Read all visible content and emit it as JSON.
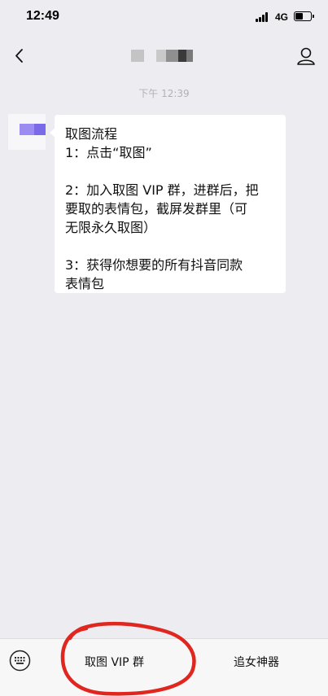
{
  "status_bar": {
    "time": "12:49",
    "network": "4G"
  },
  "chat": {
    "timestamp": "下午 12:39",
    "message": {
      "lines": [
        "取图流程",
        "1：点击“取图”",
        "",
        "2：加入取图 VIP 群，进群后，把",
        "要取的表情包，截屏发群里（可",
        "无限永久取图）",
        "",
        "3：获得你想要的所有抖音同款",
        "表情包"
      ]
    }
  },
  "bottom_menu": {
    "items": [
      "取图 VIP 群",
      "追女神器"
    ]
  },
  "colors": {
    "background": "#ededf1",
    "bubble": "#ffffff",
    "avatar_accent": "#7b6ae8",
    "annotation": "#e0271f"
  },
  "icons": {
    "back": "chevron-left-icon",
    "profile": "person-icon",
    "keyboard": "keyboard-icon"
  }
}
